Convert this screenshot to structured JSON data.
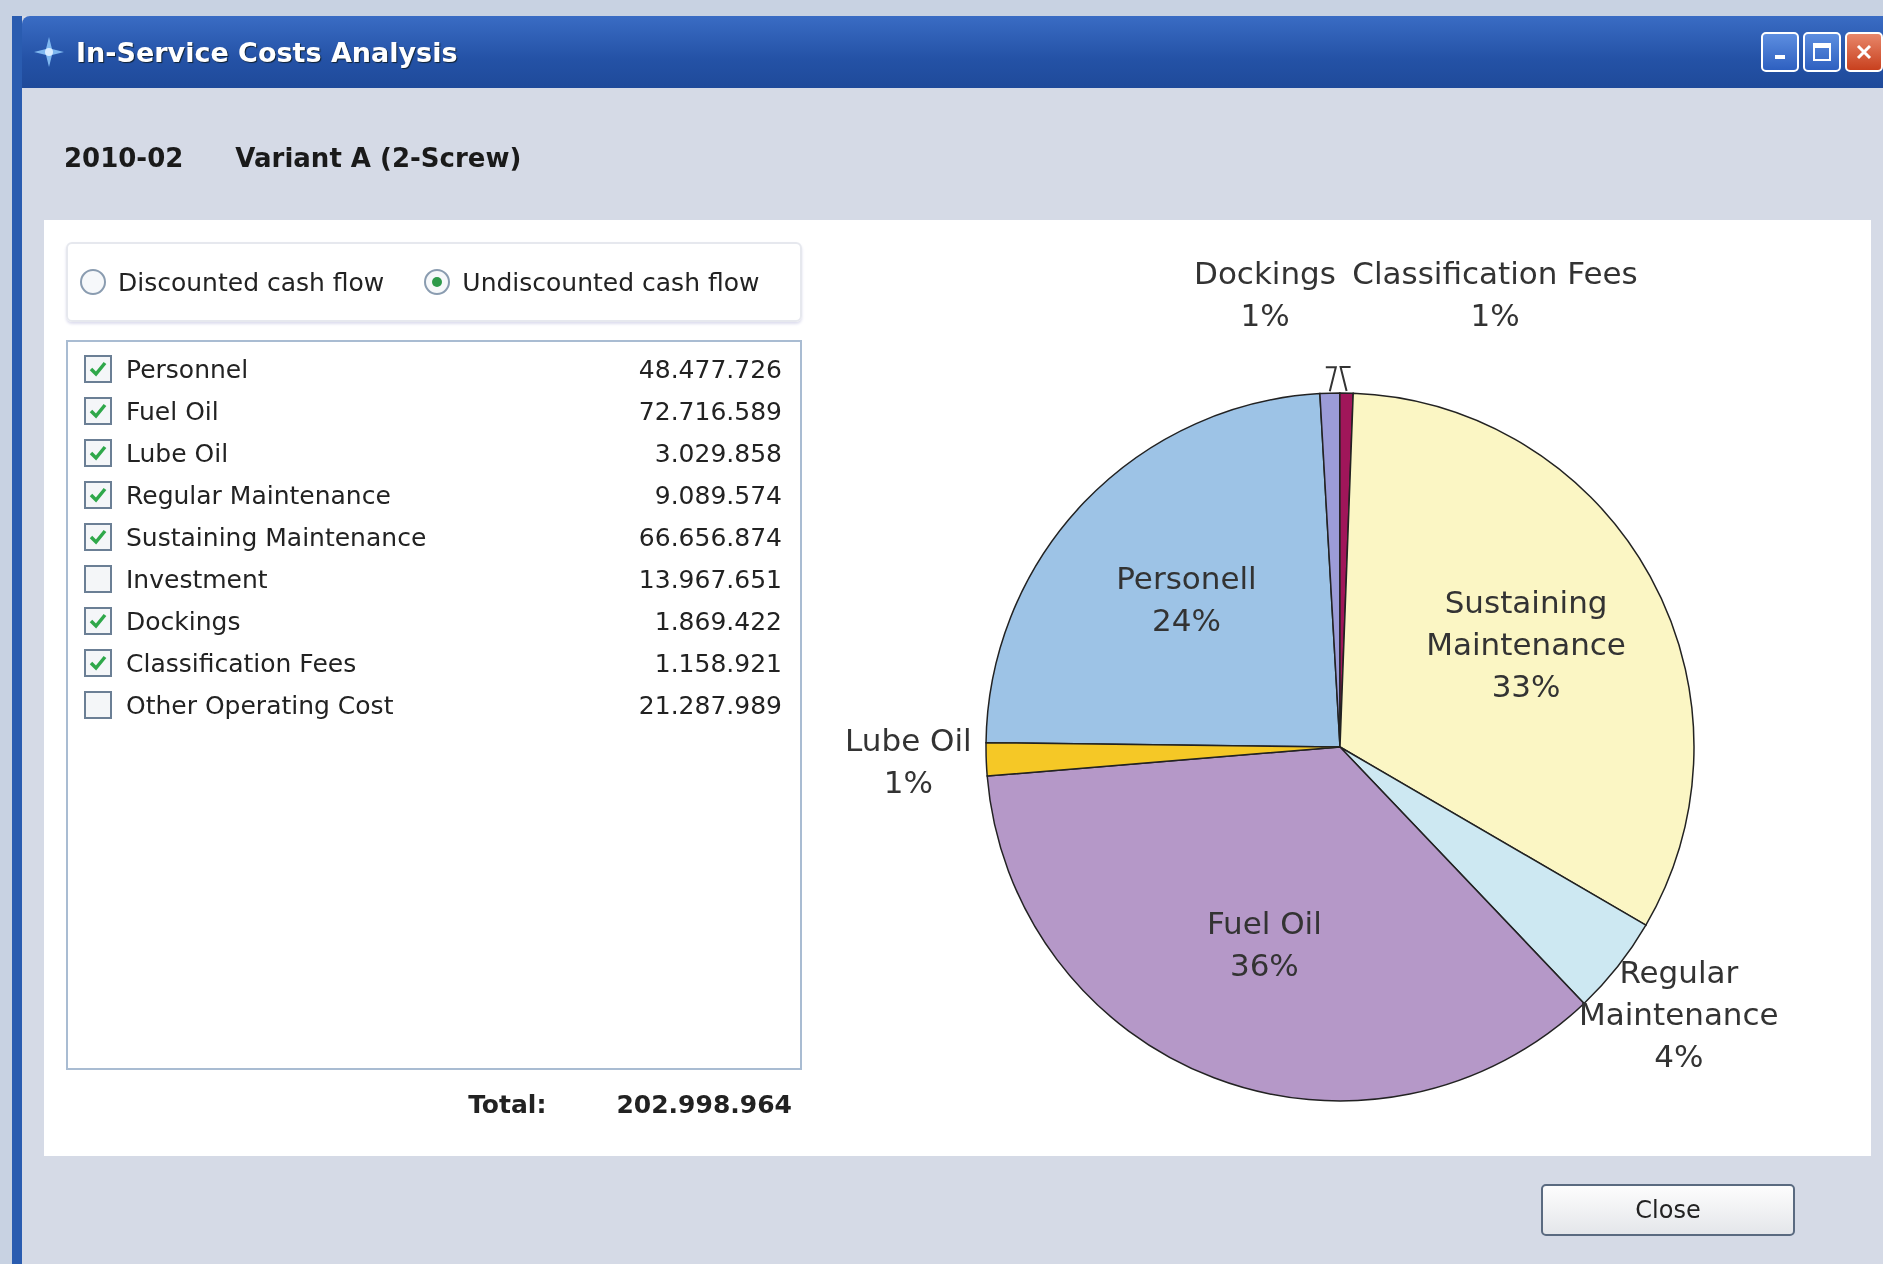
{
  "window": {
    "title": "In-Service Costs Analysis"
  },
  "header": {
    "date": "2010-02",
    "variant": "Variant A (2-Screw)"
  },
  "cash_flow_options": [
    {
      "label": "Discounted cash flow",
      "selected": false
    },
    {
      "label": "Undiscounted cash flow",
      "selected": true
    }
  ],
  "cost_items": [
    {
      "name": "Personnel",
      "value": "48.477.726",
      "checked": true
    },
    {
      "name": "Fuel Oil",
      "value": "72.716.589",
      "checked": true
    },
    {
      "name": "Lube Oil",
      "value": "3.029.858",
      "checked": true
    },
    {
      "name": "Regular Maintenance",
      "value": "9.089.574",
      "checked": true
    },
    {
      "name": "Sustaining Maintenance",
      "value": "66.656.874",
      "checked": true
    },
    {
      "name": "Investment",
      "value": "13.967.651",
      "checked": false
    },
    {
      "name": "Dockings",
      "value": "1.869.422",
      "checked": true
    },
    {
      "name": "Classification Fees",
      "value": "1.158.921",
      "checked": true
    },
    {
      "name": "Other Operating Cost",
      "value": "21.287.989",
      "checked": false
    }
  ],
  "total": {
    "label": "Total:",
    "value": "202.998.964"
  },
  "chart": {
    "chart_data": {
      "type": "pie",
      "categories": [
        "Personell",
        "Dockings",
        "Classification Fees",
        "Sustaining Maintenance",
        "Regular Maintenance",
        "Fuel Oil",
        "Lube Oil"
      ],
      "values": [
        23.9,
        0.9,
        0.6,
        32.8,
        4.5,
        35.8,
        1.5
      ],
      "colors": [
        "#9dc3e6",
        "#9c9cd8",
        "#a0165a",
        "#fbf6c4",
        "#cde8f2",
        "#b598c8",
        "#f5c826"
      ],
      "value_labels": [
        "24%",
        "1%",
        "1%",
        "33%",
        "4%",
        "36%",
        "1%"
      ]
    }
  },
  "buttons": [
    "Close"
  ]
}
